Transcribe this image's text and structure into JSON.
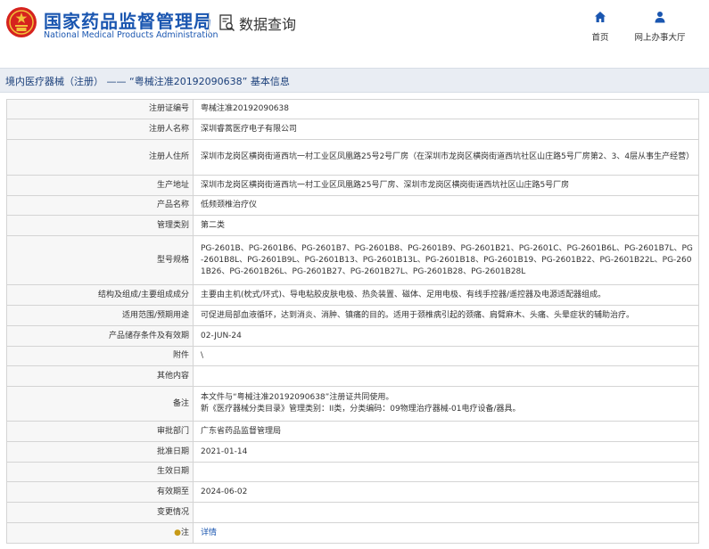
{
  "header": {
    "brand_cn": "国家药品监督管理局",
    "brand_en": "National Medical Products Administration",
    "query_label": "数据查询",
    "nav": {
      "home": "首页",
      "office": "网上办事大厅"
    }
  },
  "colors": {
    "brand_blue": "#1a56b0",
    "logo_red": "#d6231e",
    "logo_gold": "#f2c13a",
    "title_bar_bg": "#e9edf3"
  },
  "title": "境内医疗器械（注册） —— “粤械注准20192090638” 基本信息",
  "fields": {
    "reg_no": {
      "label": "注册证编号",
      "value": "粤械注准20192090638"
    },
    "registrant": {
      "label": "注册人名称",
      "value": "深圳睿蒿医疗电子有限公司"
    },
    "address": {
      "label": "注册人住所",
      "value": "深圳市龙岗区横岗街道西坑一村工业区凤凰路25号2号厂房（在深圳市龙岗区横岗街道西坑社区山庄路5号厂房第2、3、4层从事生产经营）"
    },
    "production": {
      "label": "生产地址",
      "value": "深圳市龙岗区横岗街道西坑一村工业区凤凰路25号厂房、深圳市龙岗区横岗街道西坑社区山庄路5号厂房"
    },
    "product_name": {
      "label": "产品名称",
      "value": "低频颈椎治疗仪"
    },
    "category": {
      "label": "管理类别",
      "value": "第二类"
    },
    "models": {
      "label": "型号规格",
      "value": "PG-2601B、PG-2601B6、PG-2601B7、PG-2601B8、PG-2601B9、PG-2601B21、PG-2601C、PG-2601B6L、PG-2601B7L、PG-2601B8L、PG-2601B9L、PG-2601B13、PG-2601B13L、PG-2601B18、PG-2601B19、PG-2601B22、PG-2601B22L、PG-2601B26、PG-2601B26L、PG-2601B27、PG-2601B27L、PG-2601B28、PG-2601B28L"
    },
    "structure": {
      "label": "结构及组成/主要组成成分",
      "value": "主要由主机(枕式/环式)、导电粘胶皮肤电极、热灸装置、磁体、足用电极、有线手控器/遥控器及电源适配器组成。"
    },
    "scope": {
      "label": "适用范围/预期用途",
      "value": "可促进局部血液循环，达到消炎、消肿、镇痛的目的。适用于颈椎病引起的颈痛、肩臂麻木、头痛、头晕症状的辅助治疗。"
    },
    "storage": {
      "label": "产品储存条件及有效期",
      "value": "02-JUN-24"
    },
    "attachment": {
      "label": "附件",
      "value": "\\"
    },
    "other": {
      "label": "其他内容",
      "value": ""
    },
    "remark": {
      "label": "备注",
      "line1": "本文件与“粤械注准20192090638”注册证共同使用。",
      "line2": "新《医疗器械分类目录》管理类别：II类，分类编码：09物理治疗器械-01电疗设备/器具。"
    },
    "approval_dept": {
      "label": "审批部门",
      "value": "广东省药品监督管理局"
    },
    "approval_date": {
      "label": "批准日期",
      "value": "2021-01-14"
    },
    "effective_date": {
      "label": "生效日期",
      "value": ""
    },
    "expiry_date": {
      "label": "有效期至",
      "value": "2024-06-02"
    },
    "changes": {
      "label": "变更情况",
      "value": ""
    },
    "note": {
      "label": "注",
      "value": "详情"
    }
  }
}
